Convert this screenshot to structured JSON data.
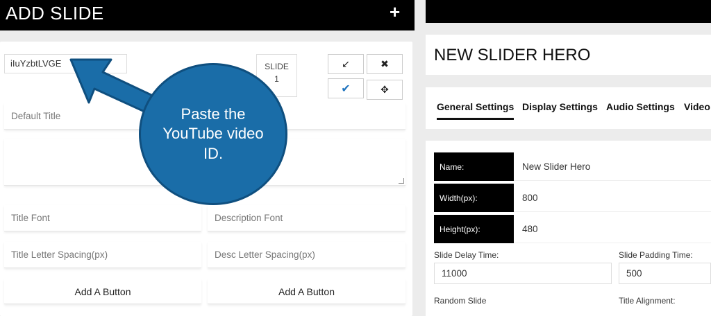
{
  "left": {
    "title": "ADD SLIDE",
    "add_icon": "plus-icon",
    "video_id_value": "iIuYzbtLVGE",
    "slide_label": "SLIDE",
    "slide_number": "1",
    "icons": {
      "collapse": "↙",
      "delete": "✖",
      "check": "✔",
      "move": "✥"
    },
    "default_title_placeholder": "Default Title",
    "title_font_placeholder": "Title Font",
    "description_font_placeholder": "Description Font",
    "title_letter_spacing_placeholder": "Title Letter Spacing(px)",
    "desc_letter_spacing_placeholder": "Desc Letter Spacing(px)",
    "add_button_label": "Add A Button",
    "add_button_label_2": "Add A Button"
  },
  "callout": {
    "text": "Paste the YouTube video ID.",
    "color": "#1a6da8"
  },
  "right": {
    "slider_title": "NEW SLIDER HERO",
    "tabs": [
      {
        "label": "General Settings"
      },
      {
        "label": "Display Settings"
      },
      {
        "label": "Audio Settings"
      },
      {
        "label": "Video"
      }
    ],
    "rows": [
      {
        "label": "Name:",
        "value": "New Slider Hero"
      },
      {
        "label": "Width(px):",
        "value": "800"
      },
      {
        "label": "Height(px):",
        "value": "480"
      }
    ],
    "slide_delay_label": "Slide Delay Time:",
    "slide_delay_value": "11000",
    "slide_padding_label": "Slide Padding Time:",
    "slide_padding_value": "500",
    "random_slide_label": "Random Slide",
    "title_alignment_label": "Title Alignment:"
  }
}
